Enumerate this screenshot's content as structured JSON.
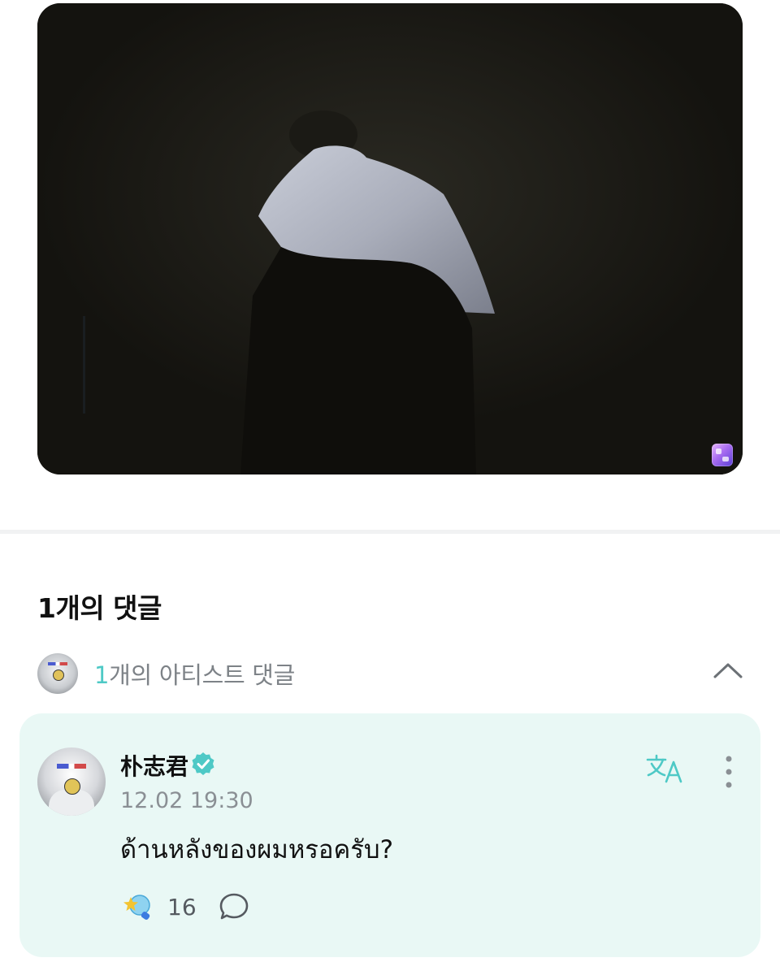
{
  "media": {
    "icons": {
      "watermark": "app-watermark-icon"
    }
  },
  "comments": {
    "heading": "1개의 댓글",
    "artist_count": "1",
    "artist_label": "개의 아티스트 댓글"
  },
  "comment": {
    "author": "朴志君",
    "timestamp": "12.02 19:30",
    "text": "ด้านหลังของผมหรอครับ?",
    "reaction_count": "16",
    "icons": {
      "verified": "verified-badge-icon",
      "translate": "translate-icon",
      "more": "more-vertical-icon",
      "reaction": "star-lightstick-icon",
      "reply": "speech-bubble-icon",
      "collapse": "chevron-up-icon"
    }
  },
  "colors": {
    "accent": "#4ec9c6",
    "card_background": "#e9f8f5",
    "muted_text": "#8a8f94"
  }
}
